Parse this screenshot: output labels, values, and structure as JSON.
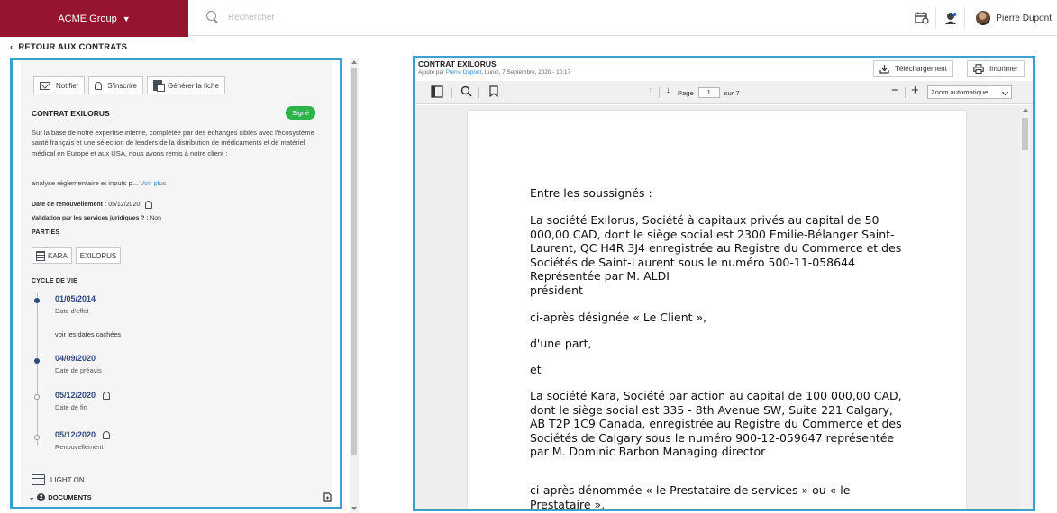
{
  "topbar": {
    "brand_label": "ACME Group",
    "brand_chevron": "chevron-down-icon",
    "search_placeholder": "Rechercher",
    "user_name": "Pierre Dupont",
    "icons": [
      "calendar-sync-icon",
      "support-user-icon"
    ]
  },
  "nav": {
    "back_label": "RETOUR AUX CONTRATS"
  },
  "actions": {
    "notify": "Notifier",
    "subscribe": "S'inscrire",
    "generate": "Générer la fiche"
  },
  "contract": {
    "title": "CONTRAT EXILORUS",
    "status": "Signé",
    "status_color": "#2db34a",
    "description": "Sur la base de notre expertise interne, complétée par des échanges ciblés avec l'écosystème santé français et une sélection de leaders de la distribution de médicaments et de matériel médical en Europe et aux USA, nous avons remis à notre client :",
    "excerpt": "analyse réglementaire et inputs p...",
    "see_more": "Voir plus",
    "renewal_label": "Date de renouvellement :",
    "renewal_value": "05/12/2020",
    "validation_label": "Validation par les services juridiques ? :",
    "validation_value": "Non"
  },
  "parties": {
    "heading": "PARTIES",
    "items": [
      "KARA",
      "EXILORUS"
    ]
  },
  "lifecycle": {
    "heading": "CYCLE DE VIE",
    "hidden_dates_link": "voir les dates cachées",
    "events": [
      {
        "date": "01/05/2014",
        "label": "Date d'effet"
      },
      {
        "date": "04/09/2020",
        "label": "Date de préavis"
      },
      {
        "date": "05/12/2020",
        "label": "Date de fin"
      },
      {
        "date": "05/12/2020",
        "label": "Renouvellement"
      }
    ]
  },
  "footer": {
    "light_label": "LIGHT ON",
    "documents_label": "DOCUMENTS",
    "documents_count": "2"
  },
  "viewer": {
    "title": "CONTRAT EXILORUS",
    "subtitle_prefix": "Ajouté par",
    "subtitle_author": "Pierre Dupont",
    "subtitle_suffix": ", Lundi, 7 Septembre, 2020 - 10:17",
    "download_label": "Téléchargement",
    "print_label": "Imprimer",
    "page_label": "Page",
    "page_current": "1",
    "page_total": "sur 7",
    "zoom_value": "Zoom automatique"
  },
  "document": {
    "p1": "Entre les soussignés :",
    "p2": "La société Exilorus, Société à capitaux privés au capital de 50 000,00 CAD, dont le siège social est 2300 Emilie-Bélanger Saint-Laurent, QC H4R 3J4 enregistrée au Registre du Commerce et des Sociétés de Saint-Laurent sous le numéro 500-11-058644 Représentée par M. ALDI",
    "p2b": "président",
    "p3": "ci-après désignée « Le Client »,",
    "p4": "d'une part,",
    "p5": "et",
    "p6": "La société Kara, Société par action au capital de 100 000,00 CAD, dont le siège social est 335 - 8th Avenue SW, Suite 221 Calgary, AB T2P 1C9 Canada, enregistrée au Registre du Commerce et des Sociétés de Calgary sous le numéro 900-12-059647 représentée par M. Dominic Barbon Managing director",
    "p7": "ci-après dénommée « le Prestataire de services » ou « le Prestataire »,"
  }
}
